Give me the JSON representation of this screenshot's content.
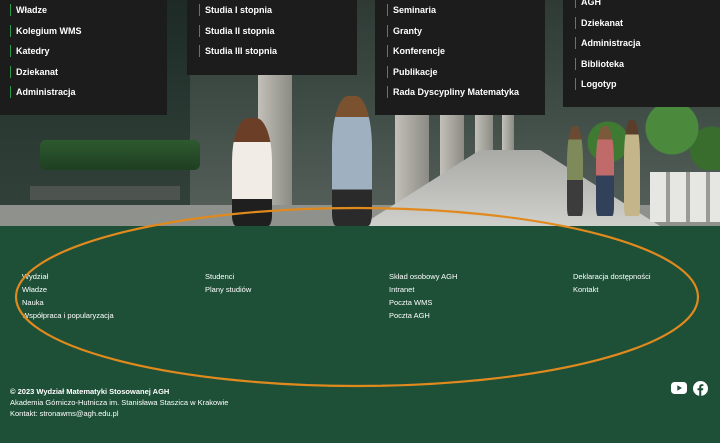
{
  "menus": {
    "col1": [
      "Władze",
      "Kolegium WMS",
      "Katedry",
      "Dziekanat",
      "Administracja"
    ],
    "col2": [
      "Studia I stopnia",
      "Studia II stopnia",
      "Studia III stopnia"
    ],
    "col3": [
      "Seminaria",
      "Granty",
      "Konferencje",
      "Publikacje",
      "Rada Dyscypliny Matematyka"
    ],
    "col4": [
      "AGH",
      "Dziekanat",
      "Administracja",
      "Biblioteka",
      "Logotyp"
    ]
  },
  "footer": {
    "col1": [
      "Wydział",
      "Władze",
      "Nauka",
      "Współpraca i popularyzacja"
    ],
    "col2": [
      "Studenci",
      "Plany studiów"
    ],
    "col3": [
      "Skład osobowy AGH",
      "Intranet",
      "Poczta WMS",
      "Poczta AGH"
    ],
    "col4": [
      "Deklaracja dostępności",
      "Kontakt"
    ],
    "copyright": "© 2023 Wydział Matematyki Stosowanej AGH",
    "university": "Akademia Górniczo-Hutnicza im. Stanisława Staszica w Krakowie",
    "contact": "Kontakt: stronawms@agh.edu.pl",
    "social_icons": [
      "youtube-icon",
      "facebook-icon"
    ]
  },
  "colors": {
    "footer_bg": "#1e5038",
    "menu_bg": "#1c1c1c",
    "menu_accent": "#2c9a4c",
    "annotation_oval": "#e08a1e"
  }
}
